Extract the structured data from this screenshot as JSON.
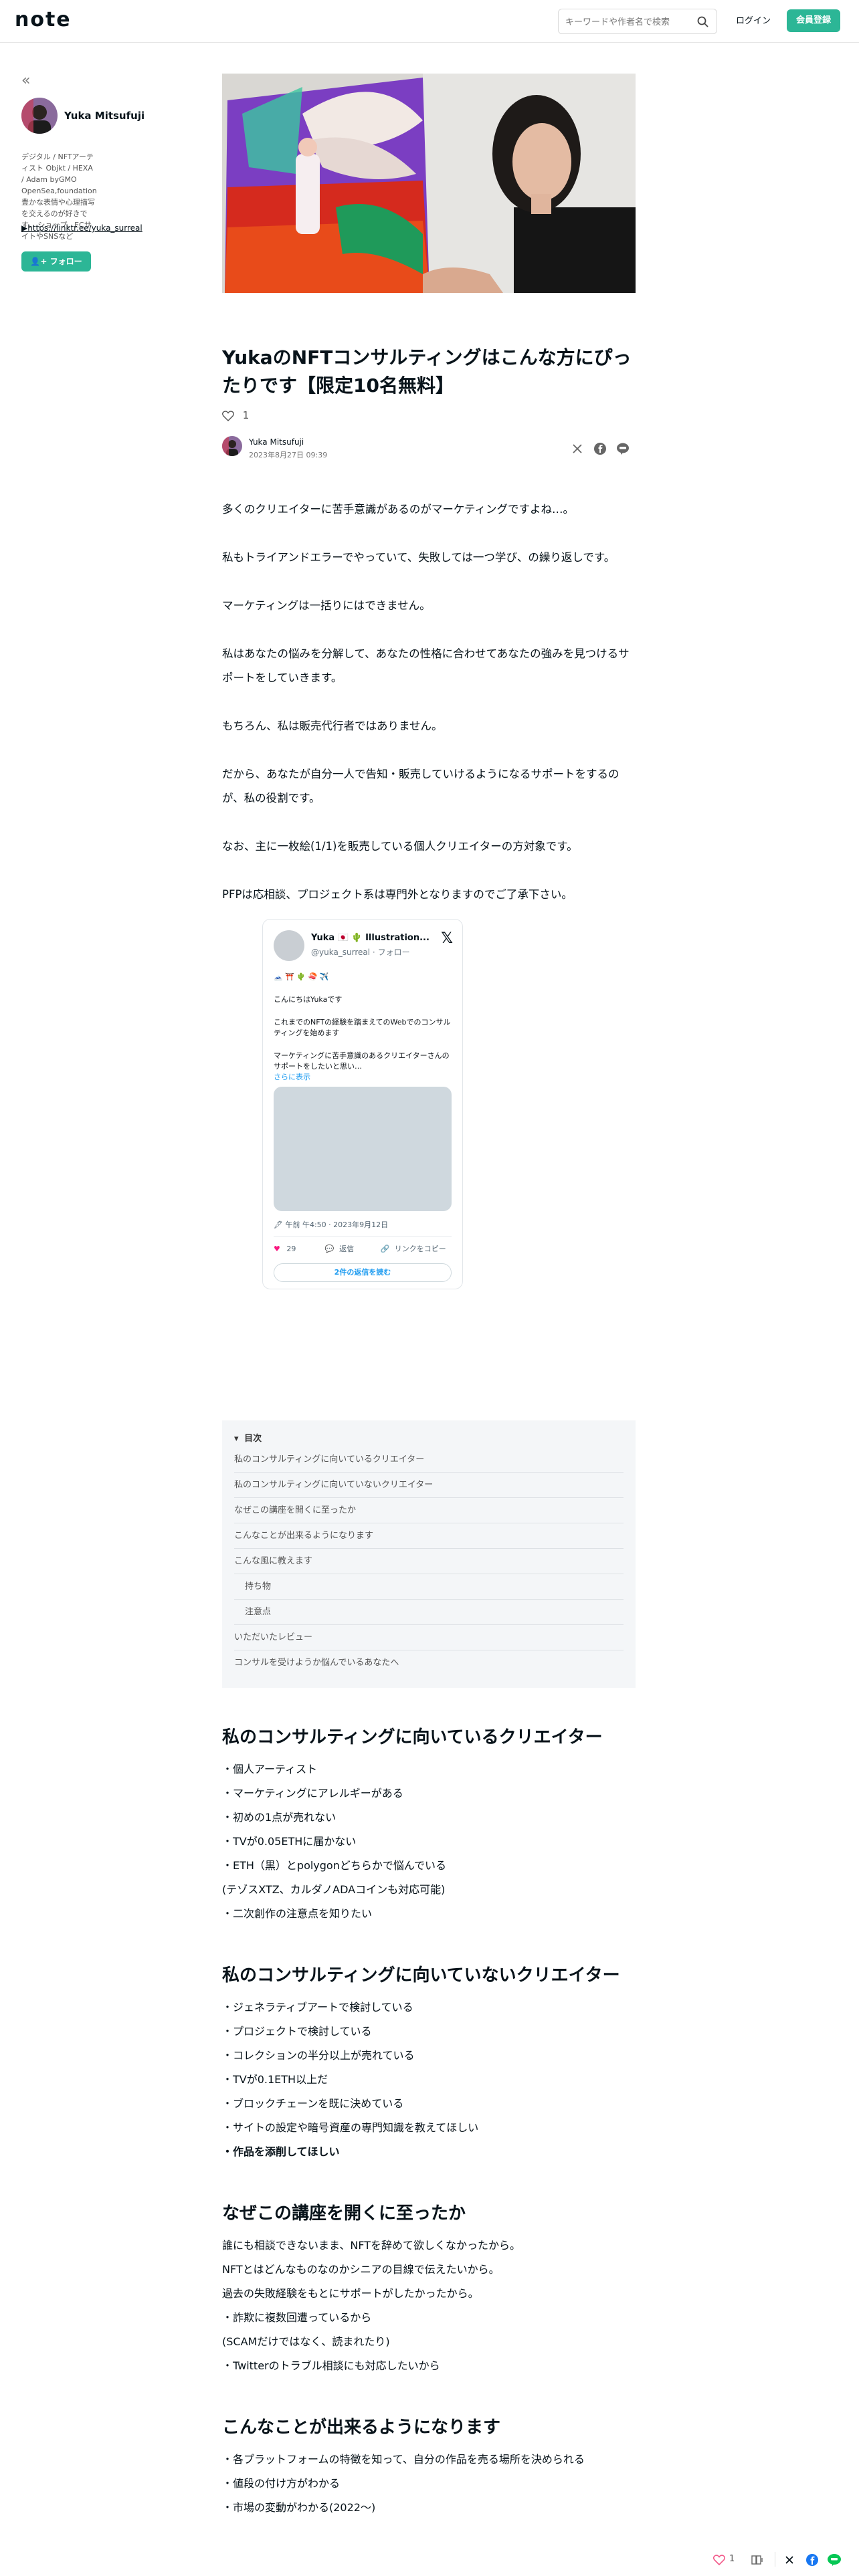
{
  "header": {
    "logo": "note",
    "search_placeholder": "キーワードや作者名で検索",
    "login_label": "ログイン",
    "signup_label": "会員登録"
  },
  "sidebar": {
    "collapse_label": "«",
    "author_name": "Yuka Mitsufuji",
    "bio": "デジタル / NFTアーティスト Objkt / HEXA / Adam byGMO OpenSea,foundation 豊かな表情や心理描写を交えるのが好きです。 ショップ、ECサイトやSNSなど",
    "link_text": "▶https://linktr.ee/yuka_surreal",
    "follow_label": "フォロー"
  },
  "article": {
    "title": "YukaのNFTコンサルティングはこんな方にぴったりです【限定10名無料】",
    "like_count": "1",
    "author_name": "Yuka Mitsufuji",
    "date": "2023年8月27日 09:39",
    "paragraphs": [
      "多くのクリエイターに苦手意識があるのがマーケティングですよね…。",
      "私もトライアンドエラーでやっていて、失敗しては一つ学び、の繰り返しです。",
      "マーケティングは一括りにはできません。",
      "私はあなたの悩みを分解して、あなたの性格に合わせてあなたの強みを見つけるサポートをしていきます。",
      "もちろん、私は販売代行者ではありません。",
      "だから、あなたが自分一人で告知・販売していけるようになるサポートをするのが、私の役割です。",
      "なお、主に一枚絵(1/1)を販売している個人クリエイターの方対象です。",
      "PFPは応相談、プロジェクト系は専門外となりますのでご了承下さい。"
    ]
  },
  "tweet": {
    "name": "Yuka 🇯🇵 🌵 Illustration...",
    "handle": "@yuka_surreal · フォロー",
    "line1": "🗻 ⛩️ 🌵 🍣 ✈️",
    "line2": "こんにちはYukaです",
    "line3": "これまでのNFTの経験を踏まえてのWebでのコンサルティングを始めます",
    "line4": "マーケティングに苦手意識のあるクリエイターさんのサポートをしたいと思い…",
    "more": "さらに表示",
    "meta": "🖋 午前 午4:50 · 2023年9月12日",
    "likes": "29",
    "reply": "返信",
    "copy": "リンクをコピー",
    "read_replies": "2件の返信を読む"
  },
  "toc": {
    "title": "目次",
    "items": [
      "私のコンサルティングに向いているクリエイター",
      "私のコンサルティングに向いていないクリエイター",
      "なぜこの講座を開くに至ったか",
      "こんなことが出来るようになります",
      "こんな風に教えます",
      "持ち物",
      "注意点",
      "いただいたレビュー",
      "コンサルを受けようか悩んでいるあなたへ"
    ]
  },
  "sections": [
    {
      "heading": "私のコンサルティングに向いているクリエイター",
      "items": [
        "・個人アーティスト",
        "・マーケティングにアレルギーがある",
        "・初めの1点が売れない",
        "・TVが0.05ETHに届かない",
        "・ETH（黒）とpolygonどちらかで悩んでいる",
        "(テゾスXTZ、カルダノADAコインも対応可能)",
        "・二次創作の注意点を知りたい"
      ]
    },
    {
      "heading": "私のコンサルティングに向いていないクリエイター",
      "items": [
        "・ジェネラティブアートで検討している",
        "・プロジェクトで検討している",
        "・コレクションの半分以上が売れている",
        "・TVが0.1ETH以上だ",
        "・ブロックチェーンを既に決めている",
        "・サイトの設定や暗号資産の専門知識を教えてほしい",
        "・作品を添削してほしい"
      ]
    },
    {
      "heading": "なぜこの講座を開くに至ったか",
      "items": [
        "誰にも相談できないまま、NFTを辞めて欲しくなかったから。",
        "NFTとはどんなものなのかシニアの目線で伝えたいから。",
        "過去の失敗経験をもとにサポートがしたかったから。",
        "・詐欺に複数回遭っているから",
        "(SCAMだけではなく、読まれたり)",
        "・Twitterのトラブル相談にも対応したいから"
      ]
    },
    {
      "heading": "こんなことが出来るようになります",
      "items": [
        "・各プラットフォームの特徴を知って、自分の作品を売る場所を決められる",
        "・値段の付け方がわかる",
        "・市場の変動がわかる(2022〜)"
      ]
    }
  ],
  "floating_bar": {
    "like_count": "1"
  },
  "colors": {
    "accent": "#2cb696",
    "text": "#08131a",
    "muted": "#777777",
    "toc_bg": "#f4f6f8",
    "heart": "#f25a8a"
  }
}
